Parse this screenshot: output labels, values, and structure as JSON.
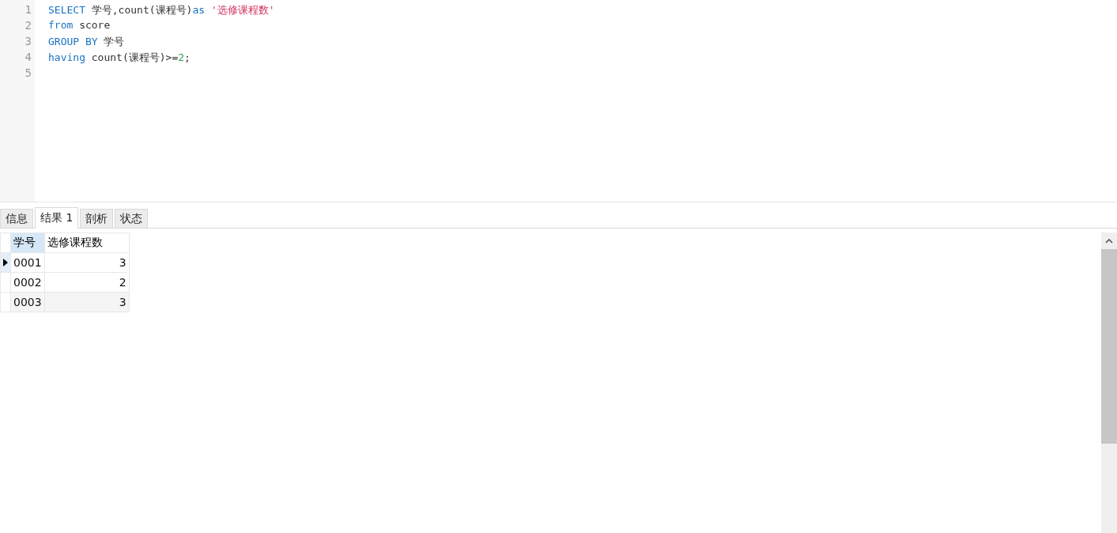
{
  "editor": {
    "lines": [
      {
        "number": "1",
        "tokens": [
          {
            "kind": "keyword",
            "text": "SELECT"
          },
          {
            "kind": "plain",
            "text": " 学号,count(课程号)"
          },
          {
            "kind": "keyword",
            "text": "as"
          },
          {
            "kind": "string",
            "text": " '选修课程数'"
          }
        ]
      },
      {
        "number": "2",
        "tokens": [
          {
            "kind": "keyword",
            "text": "from"
          },
          {
            "kind": "plain",
            "text": " score"
          }
        ]
      },
      {
        "number": "3",
        "tokens": [
          {
            "kind": "keyword",
            "text": "GROUP BY"
          },
          {
            "kind": "plain",
            "text": " 学号"
          }
        ]
      },
      {
        "number": "4",
        "tokens": [
          {
            "kind": "keyword",
            "text": "having"
          },
          {
            "kind": "plain",
            "text": " count(课程号)>="
          },
          {
            "kind": "number",
            "text": "2"
          },
          {
            "kind": "plain",
            "text": ";"
          }
        ]
      },
      {
        "number": "5"
      }
    ]
  },
  "tabs": [
    {
      "label": "信息",
      "selected": false
    },
    {
      "label": "结果 1",
      "selected": true
    },
    {
      "label": "剖析",
      "selected": false
    },
    {
      "label": "状态",
      "selected": false
    }
  ],
  "grid": {
    "columns": [
      {
        "label": "学号",
        "kind": "text",
        "selected": true
      },
      {
        "label": "选修课程数",
        "kind": "number",
        "selected": false
      }
    ],
    "rows": [
      {
        "selected": true,
        "cells": [
          "0001",
          "3"
        ]
      },
      {
        "selected": false,
        "cells": [
          "0002",
          "2"
        ]
      },
      {
        "selected": false,
        "cells": [
          "0003",
          "3"
        ]
      }
    ]
  }
}
